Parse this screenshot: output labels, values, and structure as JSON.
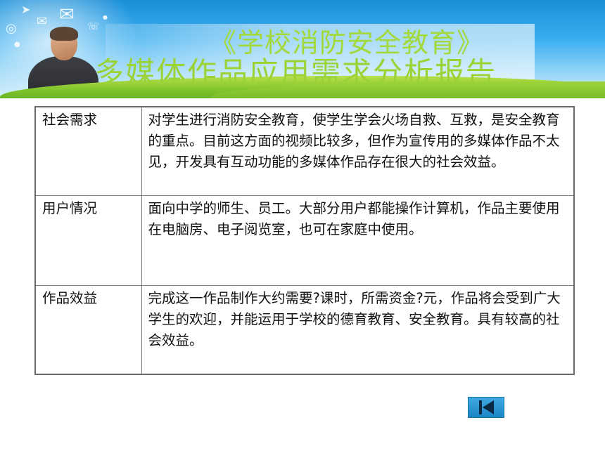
{
  "header": {
    "title_line1": "《学校消防安全教育》",
    "title_line2": "多媒体作品应用需求分析报告"
  },
  "table": {
    "rows": [
      {
        "label": "社会需求",
        "content": "对学生进行消防安全教育，使学生学会火场自救、互救，是安全教育的重点。目前这方面的视频比较多，但作为宣传用的多媒体作品不太见，开发具有互动功能的多媒体作品存在很大的社会效益。"
      },
      {
        "label": "用户情况",
        "content": "面向中学的师生、员工。大部分用户都能操作计算机，作品主要使用在电脑房、电子阅览室，也可在家庭中使用。"
      },
      {
        "label": "作品效益",
        "content": "完成这一作品制作大约需要?课时，所需资金?元，作品将会受到广大学生的欢迎，并能运用于学校的德育教育、安全教育。具有较高的社会效益。"
      }
    ]
  },
  "nav": {
    "back_icon": "skip-back-icon"
  },
  "colors": {
    "title_green": "#9bd236",
    "banner_blue": "#1a8fd8",
    "nav_blue": "#1b86c6",
    "table_border": "#6b6b6b"
  }
}
